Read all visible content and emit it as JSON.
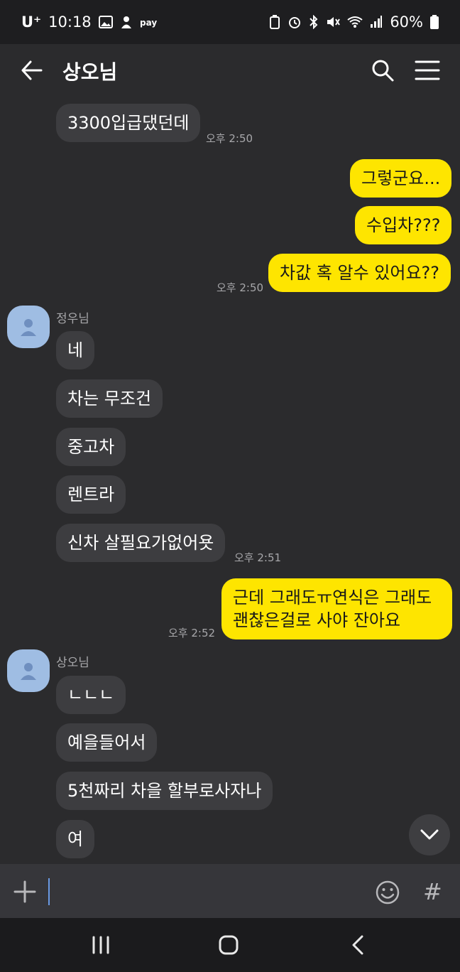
{
  "status_bar": {
    "carrier": "U⁺",
    "time": "10:18",
    "battery_pct": "60%",
    "icons_left": [
      "image-icon",
      "payment-app-icon",
      "pay-icon"
    ],
    "icons_right": [
      "battery-saver-icon",
      "alarm-icon",
      "bluetooth-icon",
      "mute-icon",
      "wifi-icon",
      "signal-icon",
      "battery-icon"
    ]
  },
  "header": {
    "title": "상오님",
    "icons": [
      "back-arrow-icon",
      "search-icon",
      "menu-icon"
    ]
  },
  "messages": [
    {
      "id": "m1",
      "dir": "in",
      "text": "3300입급댔던데",
      "time": "오후 2:50"
    },
    {
      "id": "m2",
      "dir": "out",
      "text": "그렇군요..."
    },
    {
      "id": "m3",
      "dir": "out",
      "text": "수입차???"
    },
    {
      "id": "m4",
      "dir": "out",
      "text": "차값 혹 알수 있어요??",
      "time": "오후 2:50"
    },
    {
      "id": "m5",
      "dir": "in",
      "sender": "정우님",
      "text": "네"
    },
    {
      "id": "m6",
      "dir": "in",
      "text": "차는 무조건"
    },
    {
      "id": "m7",
      "dir": "in",
      "text": "중고차"
    },
    {
      "id": "m8",
      "dir": "in",
      "text": "렌트라"
    },
    {
      "id": "m9",
      "dir": "in",
      "text": "신차 살필요가없어욧",
      "time": "오후 2:51"
    },
    {
      "id": "m10",
      "dir": "out",
      "text_line1": "근데 그래도ㅠ연식은 그래도",
      "text_line2": "괜찮은걸로 사야 잔아요",
      "time": "오후 2:52"
    },
    {
      "id": "m11",
      "dir": "in",
      "sender": "상오님",
      "text": "ㄴㄴㄴ"
    },
    {
      "id": "m12",
      "dir": "in",
      "text": "예을들어서"
    },
    {
      "id": "m13",
      "dir": "in",
      "text": "5천짜리 차을 할부로사자나"
    },
    {
      "id": "m14",
      "dir": "in",
      "text": "여"
    }
  ],
  "input": {
    "value": "",
    "icons": [
      "plus-icon",
      "emoji-icon",
      "hash-icon"
    ],
    "hash_label": "#"
  },
  "colors": {
    "background": "#2b2b2d",
    "incoming_bubble": "#3d3d40",
    "outgoing_bubble": "#fee500",
    "avatar": "#9fbde3"
  },
  "nav_icons": [
    "recent-apps-icon",
    "home-icon",
    "back-icon"
  ]
}
